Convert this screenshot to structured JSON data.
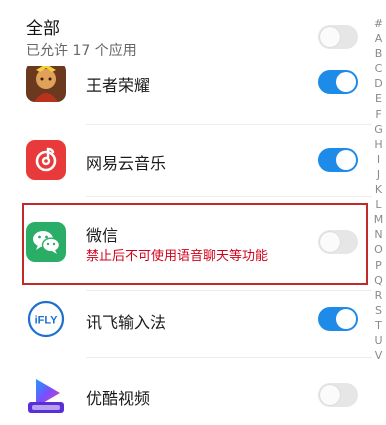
{
  "header": {
    "title": "全部",
    "subtitle": "已允许 17 个应用",
    "toggle_on": false
  },
  "apps": [
    {
      "name": "王者荣耀",
      "icon": "honor-of-kings-icon",
      "enabled": true
    },
    {
      "name": "网易云音乐",
      "icon": "netease-cloud-music-icon",
      "enabled": true
    },
    {
      "name": "微信",
      "icon": "wechat-icon",
      "enabled": false,
      "warning": "禁止后不可使用语音聊天等功能"
    },
    {
      "name": "讯飞输入法",
      "icon": "iflytek-input-icon",
      "enabled": true,
      "icon_text": "iFLY"
    },
    {
      "name": "优酷视频",
      "icon": "youku-icon",
      "enabled": false
    }
  ],
  "index": [
    "#",
    "A",
    "B",
    "C",
    "D",
    "E",
    "F",
    "G",
    "H",
    "I",
    "J",
    "K",
    "L",
    "M",
    "N",
    "O",
    "P",
    "Q",
    "R",
    "S",
    "T",
    "U",
    "V"
  ],
  "colors": {
    "accent": "#1e8be8",
    "warning": "#d0021b",
    "highlight_border": "#c22a2a"
  }
}
